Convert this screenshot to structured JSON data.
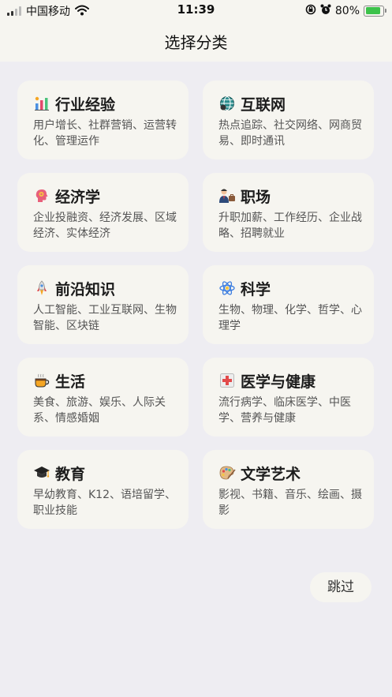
{
  "status_bar": {
    "carrier": "中国移动",
    "time": "11:39",
    "battery_percent": "80%",
    "battery_level": 0.8,
    "icons": [
      "signal-icon",
      "wifi-icon",
      "orientation-lock-icon",
      "alarm-icon",
      "battery-charging-icon"
    ]
  },
  "header": {
    "title": "选择分类"
  },
  "categories": [
    {
      "title": "行业经验",
      "desc": "用户增长、社群营销、运营转化、管理运作",
      "icon": "bar-chart-icon"
    },
    {
      "title": "互联网",
      "desc": "热点追踪、社交网络、网商贸易、即时通讯",
      "icon": "globe-icon"
    },
    {
      "title": "经济学",
      "desc": "企业投融资、经济发展、区域经济、实体经济",
      "icon": "head-gear-icon"
    },
    {
      "title": "职场",
      "desc": "升职加薪、工作经历、企业战略、招聘就业",
      "icon": "businessman-icon"
    },
    {
      "title": "前沿知识",
      "desc": "人工智能、工业互联网、生物智能、区块链",
      "icon": "rocket-icon"
    },
    {
      "title": "科学",
      "desc": "生物、物理、化学、哲学、心理学",
      "icon": "atom-icon"
    },
    {
      "title": "生活",
      "desc": "美食、旅游、娱乐、人际关系、情感婚姻",
      "icon": "coffee-cup-icon"
    },
    {
      "title": "医学与健康",
      "desc": "流行病学、临床医学、中医学、营养与健康",
      "icon": "medical-cross-icon"
    },
    {
      "title": "教育",
      "desc": "早幼教育、K12、语培留学、职业技能",
      "icon": "graduation-cap-icon"
    },
    {
      "title": "文学艺术",
      "desc": "影视、书籍、音乐、绘画、摄影",
      "icon": "palette-icon"
    }
  ],
  "skip_button": {
    "label": "跳过"
  }
}
